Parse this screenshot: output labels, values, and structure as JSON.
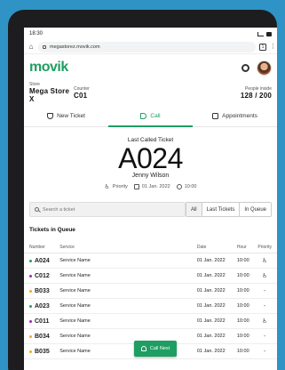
{
  "status_bar": {
    "time": "18:30"
  },
  "browser": {
    "url": "megastorez.movik.com",
    "tabs_count": "1"
  },
  "app": {
    "logo": "movik",
    "accent_color": "#1e9e62"
  },
  "store_info": {
    "store_label": "Store",
    "store_value": "Mega Store X",
    "counter_label": "Counter",
    "counter_value": "C01",
    "people_label": "People inside",
    "people_value": "128 / 200"
  },
  "nav_tabs": [
    {
      "label": "New Ticket",
      "icon": "shield-icon",
      "active": false
    },
    {
      "label": "Call",
      "icon": "megaphone-icon",
      "active": true
    },
    {
      "label": "Appointments",
      "icon": "calendar-icon",
      "active": false
    }
  ],
  "last_ticket": {
    "label": "Last Called Ticket",
    "number": "A024",
    "name": "Jenny Wilson",
    "priority": "Priority",
    "date": "01 Jan. 2022",
    "time": "10:00"
  },
  "filter": {
    "search_placeholder": "Search a ticket",
    "options": [
      "All",
      "Last Tickets",
      "In Queue"
    ],
    "selected": "All"
  },
  "queue": {
    "title": "Tickets in Queue",
    "columns": [
      "Number",
      "Service",
      "Date",
      "Hour",
      "Priority"
    ],
    "rows": [
      {
        "number": "A024",
        "service": "Service Name",
        "date": "01 Jan. 2022",
        "hour": "10:00",
        "priority": "priority-icon",
        "dot_color": "#1e9e62"
      },
      {
        "number": "C012",
        "service": "Service Name",
        "date": "01 Jan. 2022",
        "hour": "10:00",
        "priority": "priority-icon",
        "dot_color": "#9c27b0"
      },
      {
        "number": "B033",
        "service": "Service Name",
        "date": "01 Jan. 2022",
        "hour": "10:00",
        "priority": "-",
        "dot_color": "#f5a623"
      },
      {
        "number": "A023",
        "service": "Service Name",
        "date": "01 Jan. 2022",
        "hour": "10:00",
        "priority": "-",
        "dot_color": "#1e9e62"
      },
      {
        "number": "C011",
        "service": "Service Name",
        "date": "01 Jan. 2022",
        "hour": "10:00",
        "priority": "priority-icon",
        "dot_color": "#9c27b0"
      },
      {
        "number": "B034",
        "service": "Service Name",
        "date": "01 Jan. 2022",
        "hour": "10:00",
        "priority": "-",
        "dot_color": "#f5a623"
      },
      {
        "number": "B035",
        "service": "Service Name",
        "date": "01 Jan. 2022",
        "hour": "10:00",
        "priority": "-",
        "dot_color": "#f5a623"
      }
    ]
  },
  "call_next": {
    "label": "Call Next"
  }
}
